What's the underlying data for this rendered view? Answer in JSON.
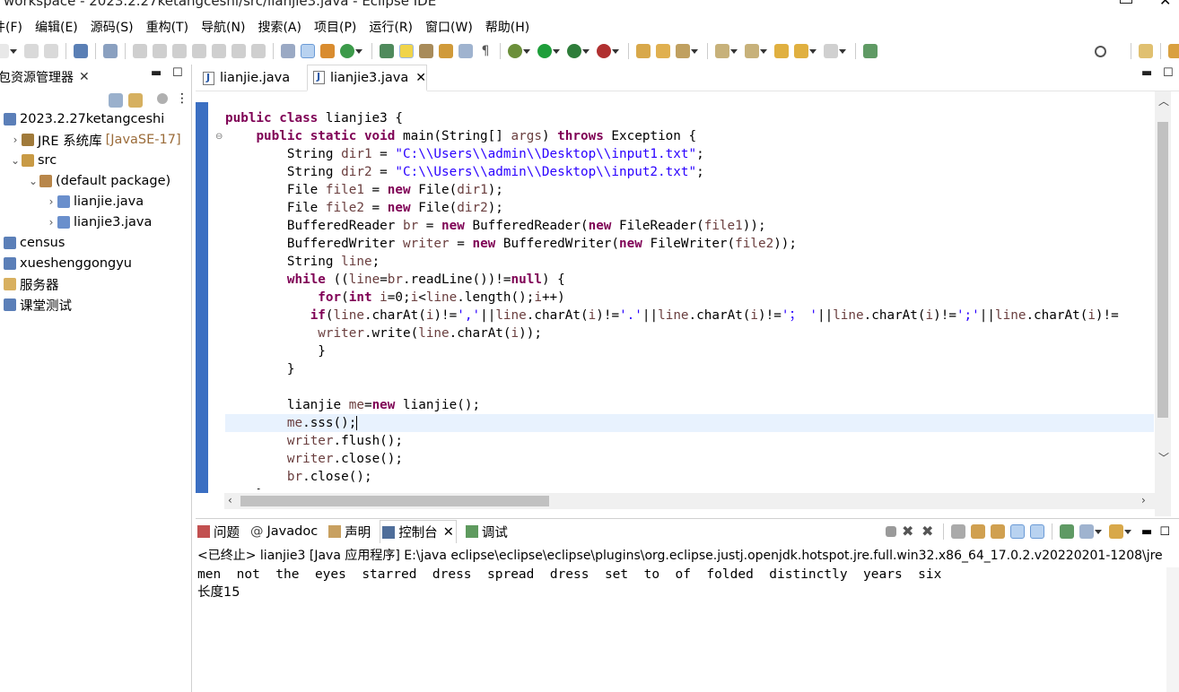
{
  "window": {
    "title": "workspace - 2023.2.27ketangceshi/src/lianjie3.java - Eclipse IDE"
  },
  "menu": [
    "件(F)",
    "编辑(E)",
    "源码(S)",
    "重构(T)",
    "导航(N)",
    "搜索(A)",
    "项目(P)",
    "运行(R)",
    "窗口(W)",
    "帮助(H)"
  ],
  "left_panel": {
    "title": "包资源管理器",
    "close_glyph": "✕",
    "tree": [
      {
        "label": "2023.2.27ketangceshi",
        "level": 0,
        "icon": "project-icon",
        "chev": ""
      },
      {
        "label": "JRE 系统库",
        "decor": "[JavaSE-17]",
        "level": 1,
        "icon": "library-icon",
        "chev": "›"
      },
      {
        "label": "src",
        "level": 1,
        "icon": "source-folder-icon",
        "chev": "⌄"
      },
      {
        "label": "(default package)",
        "level": 2,
        "icon": "package-icon",
        "chev": "⌄"
      },
      {
        "label": "lianjie.java",
        "level": 3,
        "icon": "java-file-icon",
        "chev": "›"
      },
      {
        "label": "lianjie3.java",
        "level": 3,
        "icon": "java-file-icon",
        "chev": "›"
      },
      {
        "label": "census",
        "level": 0,
        "icon": "project-icon",
        "chev": ""
      },
      {
        "label": "xueshenggongyu",
        "level": 0,
        "icon": "project-icon",
        "chev": ""
      },
      {
        "label": "服务器",
        "level": 0,
        "icon": "folder-icon",
        "chev": ""
      },
      {
        "label": "课堂测试",
        "level": 0,
        "icon": "project-icon",
        "chev": ""
      }
    ]
  },
  "editor": {
    "tabs": [
      {
        "label": "lianjie.java",
        "active": false
      },
      {
        "label": "lianjie3.java",
        "active": true,
        "close": "✕"
      }
    ],
    "current_line_index": 17,
    "code_lines": [
      [
        [
          "k",
          "public class "
        ],
        [
          "p",
          "lianjie3 {"
        ]
      ],
      [
        [
          "p",
          "    "
        ],
        [
          "k",
          "public static void "
        ],
        [
          "p",
          "main(String[] "
        ],
        [
          "v",
          "args"
        ],
        [
          "p",
          ") "
        ],
        [
          "k",
          "throws "
        ],
        [
          "p",
          "Exception {"
        ]
      ],
      [
        [
          "p",
          "        String "
        ],
        [
          "v",
          "dir1"
        ],
        [
          "p",
          " = "
        ],
        [
          "s",
          "\"C:\\\\Users\\\\admin\\\\Desktop\\\\input1.txt\""
        ],
        [
          "p",
          ";"
        ]
      ],
      [
        [
          "p",
          "        String "
        ],
        [
          "v",
          "dir2"
        ],
        [
          "p",
          " = "
        ],
        [
          "s",
          "\"C:\\\\Users\\\\admin\\\\Desktop\\\\input2.txt\""
        ],
        [
          "p",
          ";"
        ]
      ],
      [
        [
          "p",
          "        File "
        ],
        [
          "v",
          "file1"
        ],
        [
          "p",
          " = "
        ],
        [
          "k",
          "new "
        ],
        [
          "p",
          "File("
        ],
        [
          "v",
          "dir1"
        ],
        [
          "p",
          ");"
        ]
      ],
      [
        [
          "p",
          "        File "
        ],
        [
          "v",
          "file2"
        ],
        [
          "p",
          " = "
        ],
        [
          "k",
          "new "
        ],
        [
          "p",
          "File("
        ],
        [
          "v",
          "dir2"
        ],
        [
          "p",
          ");"
        ]
      ],
      [
        [
          "p",
          "        BufferedReader "
        ],
        [
          "v",
          "br"
        ],
        [
          "p",
          " = "
        ],
        [
          "k",
          "new "
        ],
        [
          "p",
          "BufferedReader("
        ],
        [
          "k",
          "new "
        ],
        [
          "p",
          "FileReader("
        ],
        [
          "v",
          "file1"
        ],
        [
          "p",
          "));"
        ]
      ],
      [
        [
          "p",
          "        BufferedWriter "
        ],
        [
          "v",
          "writer"
        ],
        [
          "p",
          " = "
        ],
        [
          "k",
          "new "
        ],
        [
          "p",
          "BufferedWriter("
        ],
        [
          "k",
          "new "
        ],
        [
          "p",
          "FileWriter("
        ],
        [
          "v",
          "file2"
        ],
        [
          "p",
          "));"
        ]
      ],
      [
        [
          "p",
          "        String "
        ],
        [
          "v",
          "line"
        ],
        [
          "p",
          ";"
        ]
      ],
      [
        [
          "p",
          "        "
        ],
        [
          "k",
          "while "
        ],
        [
          "p",
          "(("
        ],
        [
          "v",
          "line"
        ],
        [
          "p",
          "="
        ],
        [
          "v",
          "br"
        ],
        [
          "p",
          ".readLine())!="
        ],
        [
          "k",
          "null"
        ],
        [
          "p",
          ") {"
        ]
      ],
      [
        [
          "p",
          "            "
        ],
        [
          "k",
          "for"
        ],
        [
          "p",
          "("
        ],
        [
          "k",
          "int "
        ],
        [
          "v",
          "i"
        ],
        [
          "p",
          "=0;"
        ],
        [
          "v",
          "i"
        ],
        [
          "p",
          "<"
        ],
        [
          "v",
          "line"
        ],
        [
          "p",
          ".length();"
        ],
        [
          "v",
          "i"
        ],
        [
          "p",
          "++)"
        ]
      ],
      [
        [
          "p",
          "           "
        ],
        [
          "k",
          "if"
        ],
        [
          "p",
          "("
        ],
        [
          "v",
          "line"
        ],
        [
          "p",
          ".charAt("
        ],
        [
          "v",
          "i"
        ],
        [
          "p",
          ")!="
        ],
        [
          "s",
          "','"
        ],
        [
          "p",
          "||"
        ],
        [
          "v",
          "line"
        ],
        [
          "p",
          ".charAt("
        ],
        [
          "v",
          "i"
        ],
        [
          "p",
          ")!="
        ],
        [
          "s",
          "'.'"
        ],
        [
          "p",
          "||"
        ],
        [
          "v",
          "line"
        ],
        [
          "p",
          ".charAt("
        ],
        [
          "v",
          "i"
        ],
        [
          "p",
          ")!="
        ],
        [
          "s",
          "'； '"
        ],
        [
          "p",
          "||"
        ],
        [
          "v",
          "line"
        ],
        [
          "p",
          ".charAt("
        ],
        [
          "v",
          "i"
        ],
        [
          "p",
          ")!="
        ],
        [
          "s",
          "';'"
        ],
        [
          "p",
          "||"
        ],
        [
          "v",
          "line"
        ],
        [
          "p",
          ".charAt("
        ],
        [
          "v",
          "i"
        ],
        [
          "p",
          ")!="
        ]
      ],
      [
        [
          "p",
          "            "
        ],
        [
          "v",
          "writer"
        ],
        [
          "p",
          ".write("
        ],
        [
          "v",
          "line"
        ],
        [
          "p",
          ".charAt("
        ],
        [
          "v",
          "i"
        ],
        [
          "p",
          "));"
        ]
      ],
      [
        [
          "p",
          "            }"
        ]
      ],
      [
        [
          "p",
          "        }"
        ]
      ],
      [
        [
          "p",
          ""
        ]
      ],
      [
        [
          "p",
          "        lianjie "
        ],
        [
          "v",
          "me"
        ],
        [
          "p",
          "="
        ],
        [
          "k",
          "new "
        ],
        [
          "p",
          "lianjie();"
        ]
      ],
      [
        [
          "p",
          "        "
        ],
        [
          "v",
          "me"
        ],
        [
          "p",
          ".sss();"
        ]
      ],
      [
        [
          "p",
          "        "
        ],
        [
          "v",
          "writer"
        ],
        [
          "p",
          ".flush();"
        ]
      ],
      [
        [
          "p",
          "        "
        ],
        [
          "v",
          "writer"
        ],
        [
          "p",
          ".close();"
        ]
      ],
      [
        [
          "p",
          "        "
        ],
        [
          "v",
          "br"
        ],
        [
          "p",
          ".close();"
        ]
      ],
      [
        [
          "p",
          "    }"
        ]
      ]
    ]
  },
  "bottom_panel": {
    "tabs": [
      {
        "label": "问题",
        "icon": "problems-icon",
        "active": false
      },
      {
        "label": "Javadoc",
        "icon": "javadoc-icon",
        "active": false
      },
      {
        "label": "声明",
        "icon": "declaration-icon",
        "active": false
      },
      {
        "label": "控制台",
        "icon": "console-icon",
        "active": true,
        "close": "✕"
      },
      {
        "label": "调试",
        "icon": "debug-icon",
        "active": false
      }
    ],
    "console_header": "<已终止> lianjie3 [Java 应用程序] E:\\java eclipse\\eclipse\\eclipse\\plugins\\org.eclipse.justj.openjdk.hotspot.jre.full.win32.x86_64_17.0.2.v20220201-1208\\jre",
    "console_output_line1": "men  not  the  eyes  starred  dress  spread  dress  set  to  of  folded  distinctly  years  six",
    "console_output_line2": "长度15"
  },
  "colors": {
    "keyword": "#7f0055",
    "string": "#2a00ff",
    "variable": "#6a3e3e",
    "current_line": "#e8f2fe",
    "gutter": "#3b6fc2"
  }
}
